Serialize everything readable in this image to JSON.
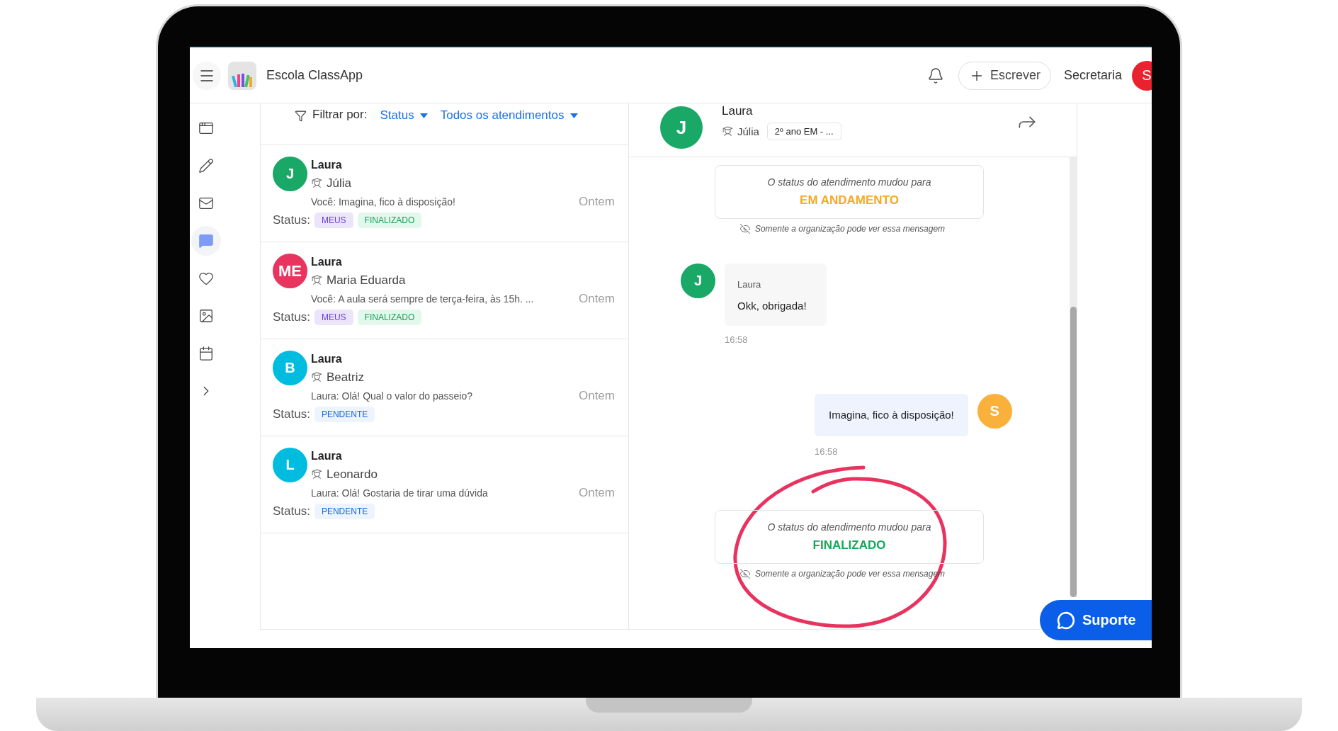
{
  "header": {
    "title": "Escola ClassApp",
    "compose_button": "Escrever",
    "account": "Secretaria",
    "account_avatar": "S"
  },
  "sidebar": {
    "items": [
      {
        "kind": "window",
        "selected": false
      },
      {
        "kind": "pencil",
        "selected": false
      },
      {
        "kind": "mail",
        "selected": false
      },
      {
        "kind": "chat",
        "selected": true
      },
      {
        "kind": "heart",
        "selected": false
      },
      {
        "kind": "image",
        "selected": false
      },
      {
        "kind": "calendar",
        "selected": false
      },
      {
        "kind": "chevron",
        "selected": false
      }
    ]
  },
  "filter": {
    "label": "Filtrar por:",
    "dropdowns": [
      "Status",
      "Todos os atendimentos"
    ]
  },
  "conversations": [
    {
      "avatar": "J",
      "color": "#19a866",
      "name": "Laura",
      "student": "Júlia",
      "preview": "Você: Imagina, fico à disposição!",
      "time": "Ontem",
      "status_label": "Status:",
      "tags": [
        {
          "label": "MEUS",
          "kind": "mine"
        },
        {
          "label": "FINALIZADO",
          "kind": "finished"
        }
      ]
    },
    {
      "avatar": "ME",
      "color": "#e8355f",
      "name": "Laura",
      "student": "Maria Eduarda",
      "preview": "Você: A aula será sempre de terça-feira, às 15h. ...",
      "time": "Ontem",
      "status_label": "Status:",
      "tags": [
        {
          "label": "MEUS",
          "kind": "mine"
        },
        {
          "label": "FINALIZADO",
          "kind": "finished"
        }
      ]
    },
    {
      "avatar": "B",
      "color": "#00bde0",
      "name": "Laura",
      "student": "Beatriz",
      "preview": "Laura: Olá! Qual o valor do passeio?",
      "time": "Ontem",
      "status_label": "Status:",
      "tags": [
        {
          "label": "PENDENTE",
          "kind": "pending"
        }
      ]
    },
    {
      "avatar": "L",
      "color": "#00bde0",
      "name": "Laura",
      "student": "Leonardo",
      "preview": "Laura: Olá! Gostaria de tirar uma dúvida",
      "time": "Ontem",
      "status_label": "Status:",
      "tags": [
        {
          "label": "PENDENTE",
          "kind": "pending"
        }
      ]
    }
  ],
  "chat": {
    "header": {
      "avatar": "J",
      "name": "Laura",
      "student": "Júlia",
      "class": "2º ano EM - ..."
    },
    "messages": [
      {
        "kind": "status",
        "intro": "O status do atendimento mudou para",
        "status": "EM ANDAMENTO",
        "color": "#f7a823",
        "note": "Somente a organização pode ver essa mensagem"
      },
      {
        "kind": "incoming",
        "avatar": "J",
        "color": "#19a866",
        "author": "Laura",
        "text": "Okk, obrigada!",
        "time": "16:58"
      },
      {
        "kind": "outgoing",
        "avatar": "S",
        "color": "#f9b13c",
        "text": "Imagina, fico à disposição!",
        "time": "16:58"
      },
      {
        "kind": "status",
        "intro": "O status do atendimento mudou para",
        "status": "FINALIZADO",
        "color": "#18a85a",
        "note": "Somente a organização pode ver essa mensagem"
      }
    ]
  },
  "support_button": "Suporte"
}
